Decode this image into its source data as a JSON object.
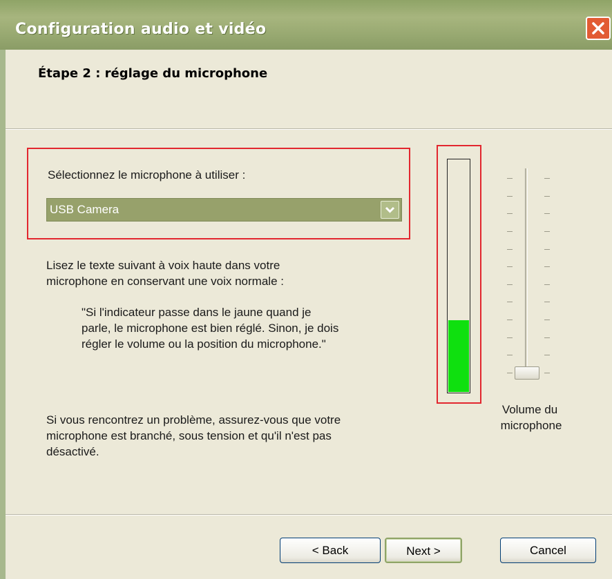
{
  "window": {
    "title": "Configuration audio et vidéo"
  },
  "header": {
    "step": "Étape 2 : réglage du microphone"
  },
  "mic_select": {
    "label": "Sélectionnez le microphone à utiliser :",
    "selected": "USB Camera"
  },
  "instructions": {
    "line1": "Lisez le texte suivant à voix haute dans votre",
    "line2": "microphone en conservant une voix normale :"
  },
  "quote": {
    "line1": "\"Si l'indicateur passe dans le jaune quand je",
    "line2": "parle, le microphone est bien réglé. Sinon, je dois",
    "line3": "régler le volume ou la position du microphone.\""
  },
  "help": {
    "line1": "Si vous rencontrez un problème, assurez-vous que votre",
    "line2": "microphone est branché, sous tension et qu'il n'est pas",
    "line3": "désactivé."
  },
  "level_meter": {
    "level_fraction": 0.31,
    "fill_color": "#0fe00f"
  },
  "volume_slider": {
    "label_line1": "Volume du",
    "label_line2": "microphone",
    "value_fraction": 0.0
  },
  "buttons": {
    "back": "< Back",
    "next": "Next >",
    "cancel": "Cancel"
  },
  "colors": {
    "highlight": "#e2262e",
    "titlebar": "#98a971",
    "dropdown": "#97a16b"
  }
}
